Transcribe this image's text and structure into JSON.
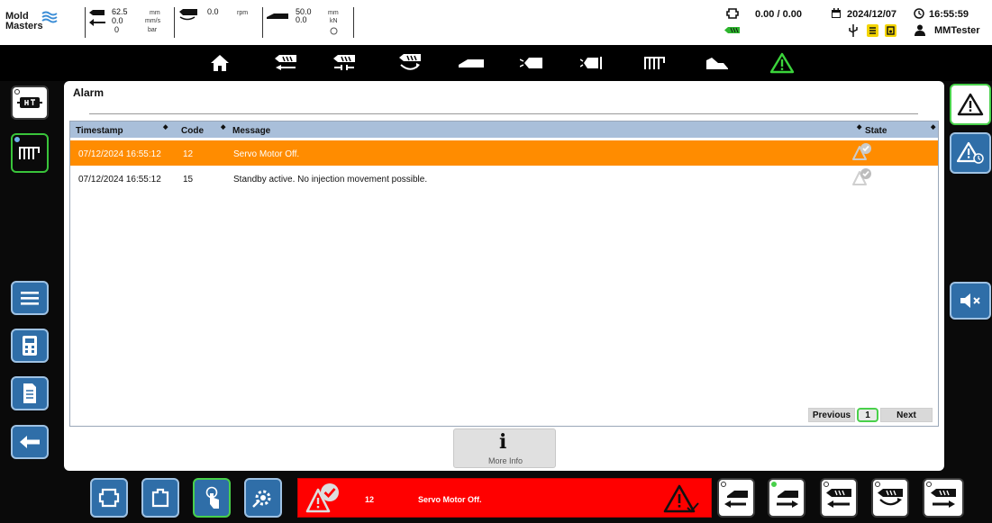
{
  "topbar": {
    "logo_line1": "Mold",
    "logo_line2": "Masters",
    "inj_position": "62.5",
    "inj_position_unit": "mm",
    "inj_speed": "0.0",
    "inj_speed_unit": "mm/s",
    "inj_pressure": "0",
    "inj_pressure_unit": "bar",
    "screw_rpm": "0.0",
    "screw_rpm_unit": "rpm",
    "carriage_position": "50.0",
    "carriage_position_unit": "mm",
    "carriage_force": "0.0",
    "carriage_force_unit": "kN",
    "counter": "0.00 / 0.00",
    "date": "2024/12/07",
    "time": "16:55:59",
    "user": "MMTester"
  },
  "nav": {
    "icons": [
      "home-icon",
      "injection-icon",
      "hold-icon",
      "screw-icon",
      "carriage-icon",
      "valve-icon",
      "valve-sequence-icon",
      "heater-icon",
      "profile-icon",
      "alarm-icon"
    ]
  },
  "alarm_page": {
    "title": "Alarm",
    "columns": {
      "timestamp": "Timestamp",
      "code": "Code",
      "message": "Message",
      "state": "State"
    },
    "rows": [
      {
        "timestamp": "07/12/2024 16:55:12",
        "code": "12",
        "message": "Servo Motor Off.",
        "selected": true
      },
      {
        "timestamp": "07/12/2024 16:55:12",
        "code": "15",
        "message": "Standby active. No injection movement possible.",
        "selected": false
      }
    ],
    "pager": {
      "previous": "Previous",
      "page": "1",
      "next": "Next"
    },
    "more_info": {
      "icon_glyph": "i",
      "label": "More Info"
    }
  },
  "alarm_bar": {
    "code": "12",
    "message": "Servo Motor Off."
  },
  "colors": {
    "selected_row": "#ff8c00",
    "table_header": "#a9bfda",
    "active_outline": "#49d04b",
    "alarm_bar": "#ff0000",
    "button_blue": "#2f6ea8"
  }
}
